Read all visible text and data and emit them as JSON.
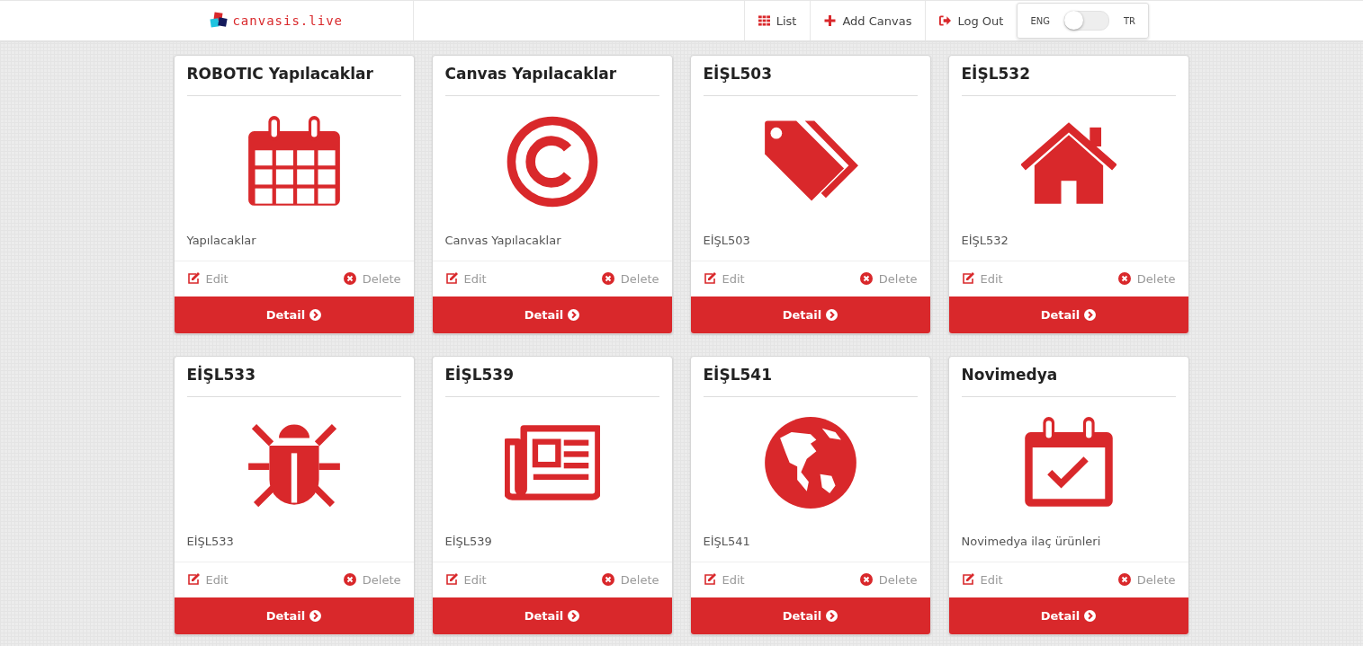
{
  "logo": {
    "text": "canvasis.live"
  },
  "nav": [
    {
      "kind": "list",
      "label": "List"
    },
    {
      "kind": "add",
      "label": "Add Canvas"
    },
    {
      "kind": "logout",
      "label": "Log Out"
    }
  ],
  "language_toggle": {
    "left_label": "ENG",
    "right_label": "TR",
    "on": false
  },
  "cards": [
    {
      "title": "ROBOTIC Yapılacaklar",
      "kind": "calendar",
      "description": "Yapılacaklar",
      "edit": "Edit",
      "delete": "Delete",
      "detail": "Detail"
    },
    {
      "title": "Canvas Yapılacaklar",
      "kind": "copyright",
      "description": "Canvas Yapılacaklar",
      "edit": "Edit",
      "delete": "Delete",
      "detail": "Detail"
    },
    {
      "title": "EİŞL503",
      "kind": "tags",
      "description": "EİŞL503",
      "edit": "Edit",
      "delete": "Delete",
      "detail": "Detail"
    },
    {
      "title": "EİŞL532",
      "kind": "home",
      "description": "EİŞL532",
      "edit": "Edit",
      "delete": "Delete",
      "detail": "Detail"
    },
    {
      "title": "EİŞL533",
      "kind": "bug",
      "description": "EİŞL533",
      "edit": "Edit",
      "delete": "Delete",
      "detail": "Detail"
    },
    {
      "title": "EİŞL539",
      "kind": "newspaper",
      "description": "EİŞL539",
      "edit": "Edit",
      "delete": "Delete",
      "detail": "Detail"
    },
    {
      "title": "EİŞL541",
      "kind": "globe",
      "description": "EİŞL541",
      "edit": "Edit",
      "delete": "Delete",
      "detail": "Detail"
    },
    {
      "title": "Novimedya",
      "kind": "calendar-check",
      "description": "Novimedya ilaç ürünleri",
      "edit": "Edit",
      "delete": "Delete",
      "detail": "Detail"
    }
  ]
}
